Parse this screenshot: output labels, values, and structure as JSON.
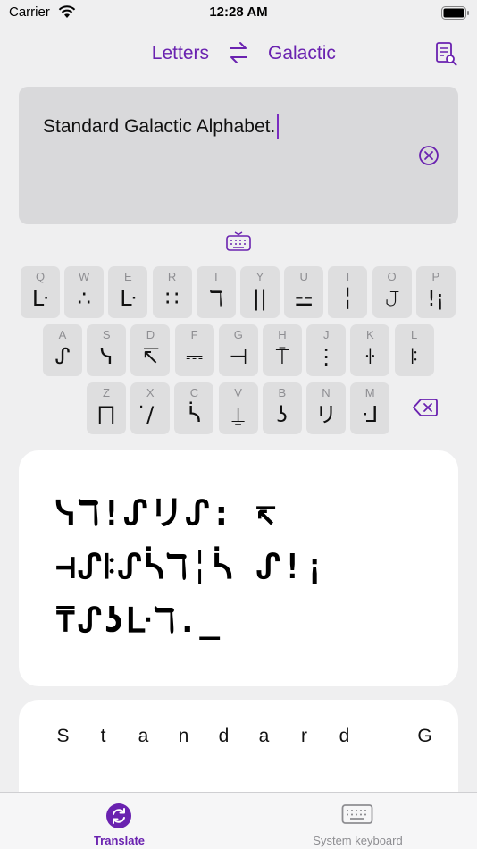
{
  "status": {
    "carrier": "Carrier",
    "time": "12:28 AM"
  },
  "nav": {
    "source_language": "Letters",
    "target_language": "Galactic"
  },
  "input": {
    "text": "Standard Galactic Alphabet."
  },
  "keyboard": {
    "rows": [
      [
        {
          "letter": "Q",
          "glyph": "ᒷ"
        },
        {
          "letter": "W",
          "glyph": "∴"
        },
        {
          "letter": "E",
          "glyph": "ᒷ"
        },
        {
          "letter": "R",
          "glyph": "∷"
        },
        {
          "letter": "T",
          "glyph": "ℸ"
        },
        {
          "letter": "Y",
          "glyph": "||"
        },
        {
          "letter": "U",
          "glyph": "⚍"
        },
        {
          "letter": "I",
          "glyph": "╎"
        },
        {
          "letter": "O",
          "glyph": "𝙹"
        },
        {
          "letter": "P",
          "glyph": "!¡"
        }
      ],
      [
        {
          "letter": "A",
          "glyph": "ᔑ"
        },
        {
          "letter": "S",
          "glyph": "ᓭ"
        },
        {
          "letter": "D",
          "glyph": "↸"
        },
        {
          "letter": "F",
          "glyph": "⎓"
        },
        {
          "letter": "G",
          "glyph": "⊣"
        },
        {
          "letter": "H",
          "glyph": "⍑"
        },
        {
          "letter": "J",
          "glyph": "⋮"
        },
        {
          "letter": "K",
          "glyph": "ꖌ"
        },
        {
          "letter": "L",
          "glyph": "ꖎ"
        }
      ],
      [
        {
          "letter": "Z",
          "glyph": "⨅"
        },
        {
          "letter": "X",
          "glyph": "̇/"
        },
        {
          "letter": "C",
          "glyph": "ᓵ"
        },
        {
          "letter": "V",
          "glyph": "⍊"
        },
        {
          "letter": "B",
          "glyph": "ʖ"
        },
        {
          "letter": "N",
          "glyph": "リ"
        },
        {
          "letter": "M",
          "glyph": "ᒲ"
        }
      ]
    ]
  },
  "output": {
    "lines": [
      "ᓭℸ̣ᔑリ↸ᔑ∷↸ ⊣ᔑꖎᔑᓵℸ̣╎ᓵ ᔑ!¡⍑ᔑʖᒷℸ̣.",
      "",
      ""
    ],
    "display_lines": [
      "ᓭℸ!ᔑリᔑ: ↸",
      "⊣ᔑꖎᔑᓵℸ╎ᓵ ᔑ!¡",
      "⍑ᔑʖᒷℸ._"
    ]
  },
  "spelled": {
    "chars": [
      "S",
      "t",
      "a",
      "n",
      "d",
      "a",
      "r",
      "d",
      "",
      "G"
    ]
  },
  "tabs": {
    "translate_label": "Translate",
    "keyboard_label": "System keyboard"
  },
  "colors": {
    "accent": "#6a22b0",
    "background": "#efeff0",
    "card": "#ffffff"
  }
}
